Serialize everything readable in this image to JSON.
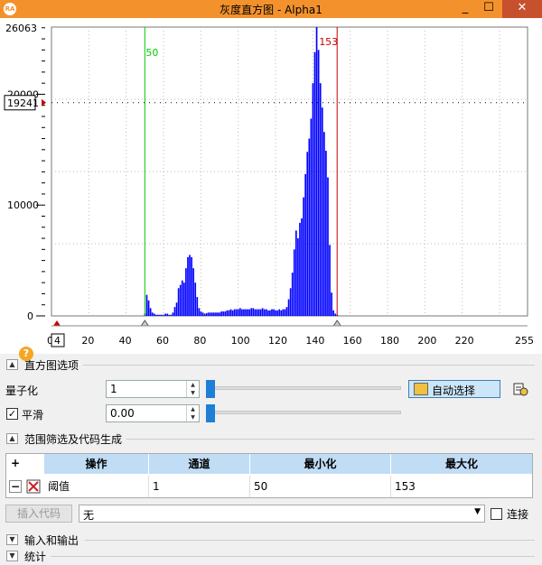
{
  "window": {
    "title": "灰度直方图 - Alpha1",
    "logo": "RA",
    "min": "_",
    "max": "☐",
    "close": "✕"
  },
  "histogram": {
    "y_max_label": "26063",
    "y_mid_label": "20000",
    "y_ten_label": "10000",
    "y_zero_label": "0",
    "y_marker_value": "19241",
    "x_zero_label": "0",
    "x_small_label": "4",
    "low_marker_label": "50",
    "high_marker_label": "153",
    "x_tick_labels": [
      "20",
      "40",
      "60",
      "80",
      "100",
      "120",
      "140",
      "160",
      "180",
      "200",
      "220",
      "255"
    ]
  },
  "chart_data": {
    "type": "bar",
    "title": "",
    "xlabel": "",
    "ylabel": "",
    "xlim": [
      0,
      255
    ],
    "ylim": [
      0,
      26063
    ],
    "grid": true,
    "low_marker": 50,
    "high_marker": 153,
    "threshold_y": 19241,
    "x": [
      50,
      51,
      52,
      53,
      54,
      55,
      56,
      57,
      58,
      59,
      60,
      61,
      62,
      63,
      64,
      65,
      66,
      67,
      68,
      69,
      70,
      71,
      72,
      73,
      74,
      75,
      76,
      77,
      78,
      79,
      80,
      81,
      82,
      83,
      84,
      85,
      86,
      87,
      88,
      89,
      90,
      91,
      92,
      93,
      94,
      95,
      96,
      97,
      98,
      99,
      100,
      101,
      102,
      103,
      104,
      105,
      106,
      107,
      108,
      109,
      110,
      111,
      112,
      113,
      114,
      115,
      116,
      117,
      118,
      119,
      120,
      121,
      122,
      123,
      124,
      125,
      126,
      127,
      128,
      129,
      130,
      131,
      132,
      133,
      134,
      135,
      136,
      137,
      138,
      139,
      140,
      141,
      142,
      143,
      144,
      145,
      146,
      147,
      148,
      149,
      150,
      151,
      152,
      153
    ],
    "values": [
      200,
      1900,
      1400,
      700,
      300,
      200,
      100,
      100,
      100,
      100,
      100,
      200,
      200,
      100,
      100,
      300,
      800,
      1200,
      2500,
      2800,
      3200,
      3000,
      4300,
      5300,
      5500,
      5300,
      4300,
      3000,
      1700,
      700,
      400,
      300,
      200,
      250,
      300,
      300,
      300,
      300,
      300,
      300,
      300,
      400,
      400,
      400,
      500,
      500,
      600,
      500,
      600,
      600,
      600,
      700,
      600,
      600,
      600,
      600,
      600,
      700,
      700,
      600,
      600,
      600,
      600,
      700,
      600,
      600,
      500,
      500,
      600,
      600,
      500,
      500,
      600,
      500,
      600,
      600,
      800,
      1500,
      2500,
      3900,
      6000,
      7700,
      7000,
      8400,
      8800,
      10700,
      12800,
      14800,
      16000,
      17800,
      21000,
      23800,
      26063,
      24000,
      21000,
      18800,
      16600,
      14900,
      12500,
      6400,
      2100,
      500,
      200,
      100
    ]
  },
  "options": {
    "header": "直方图选项",
    "quantize_label": "量子化",
    "quantize_value": "1",
    "smooth_label": "平滑",
    "smooth_checked": "✓",
    "smooth_value": "0.00",
    "auto_select_label": "自动选择"
  },
  "range": {
    "header": "范围筛选及代码生成",
    "columns": [
      "操作",
      "通道",
      "最小化",
      "最大化"
    ],
    "add_symbol": "+",
    "remove_symbol": "−",
    "row": {
      "op": "阈值",
      "channel": "1",
      "min": "50",
      "max": "153"
    }
  },
  "code": {
    "insert_label": "插入代码",
    "combo_value": "无",
    "connect_label": "连接"
  },
  "footer": {
    "io_header": "输入和输出",
    "stats_header": "统计"
  },
  "colors": {
    "title_bar": "#f3922c",
    "bars": "#0000ff",
    "low_marker": "#00cc00",
    "high_marker": "#cc0000",
    "table_header": "#c1dcf5",
    "slider": "#1e7fd4"
  },
  "icons": {
    "help": "help-icon",
    "auto": "auto-select-icon",
    "side": "report-icon"
  }
}
